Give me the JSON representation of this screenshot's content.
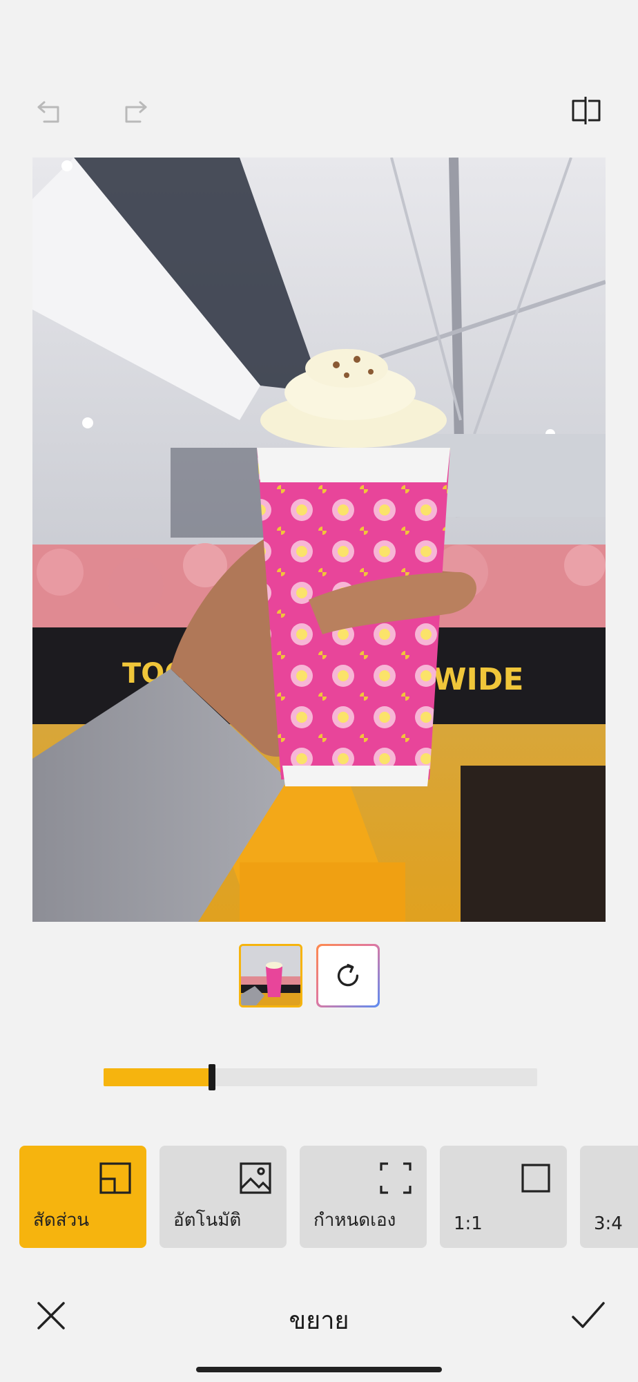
{
  "toolbar": {
    "undo_icon": "undo-icon",
    "redo_icon": "redo-icon",
    "compare_icon": "compare-split-icon"
  },
  "preview": {
    "neon_sign_left": "TOO",
    "neon_sign_right": "WIDE"
  },
  "strip": {
    "items": [
      {
        "icon": "photo-thumbnail",
        "selected": true
      },
      {
        "icon": "rotate-icon",
        "selected": false
      }
    ]
  },
  "slider": {
    "value": 0.25,
    "fill_color": "#f6b40e"
  },
  "ratio_options": [
    {
      "label": "สัดส่วน",
      "icon": "aspect-ratio-icon",
      "active": true
    },
    {
      "label": "อัตโนมัติ",
      "icon": "image-auto-icon",
      "active": false
    },
    {
      "label": "กำหนดเอง",
      "icon": "freeform-crop-icon",
      "active": false
    },
    {
      "label": "1:1",
      "icon": "square-icon",
      "active": false
    },
    {
      "label": "3:4",
      "icon": "portrait-icon",
      "active": false
    }
  ],
  "bottom": {
    "cancel_icon": "close-icon",
    "title": "ขยาย",
    "confirm_icon": "check-icon"
  },
  "colors": {
    "accent": "#f6b40e",
    "background": "#f2f2f2",
    "card": "#dcdcdc"
  }
}
